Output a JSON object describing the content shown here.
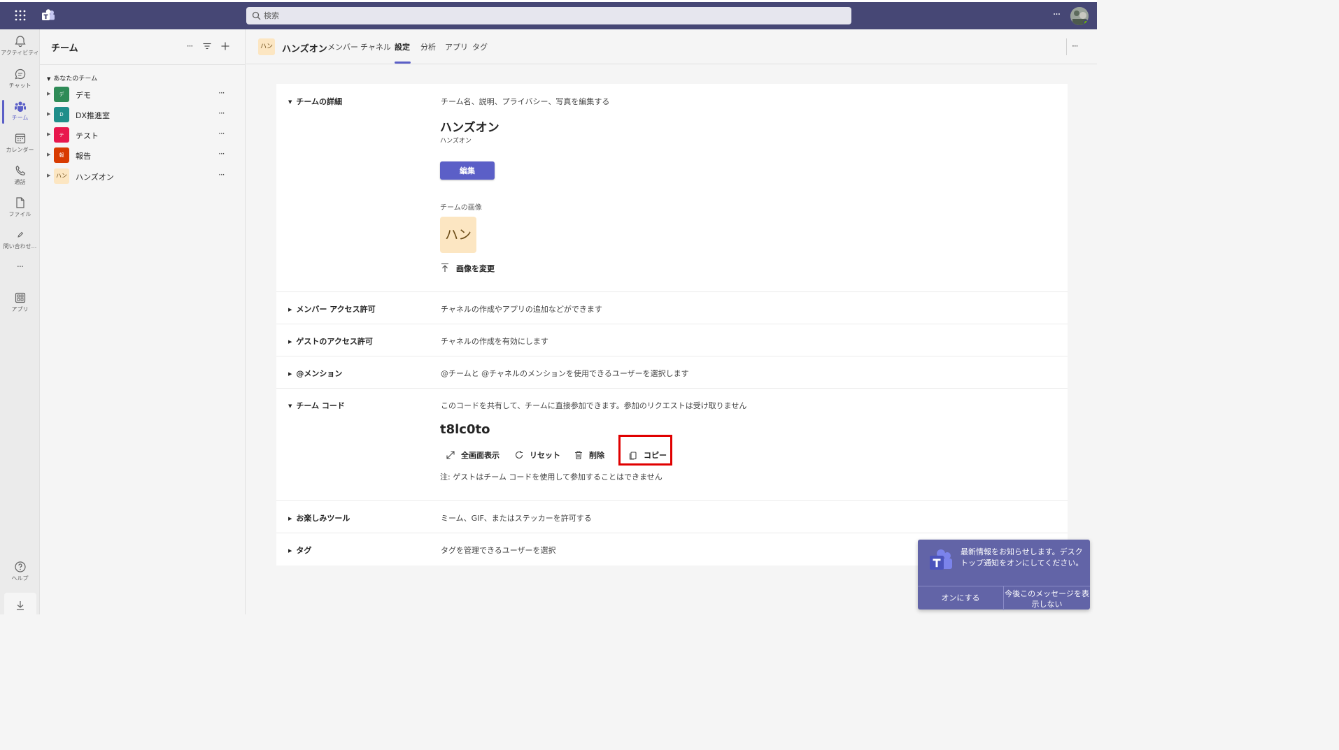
{
  "app": {
    "search_placeholder": "検索",
    "more": "···",
    "colors": {
      "header": "#464775",
      "accent": "#5b5fc7",
      "highlight": "#e00000"
    }
  },
  "rail": {
    "items": [
      {
        "label": "アクティビティ",
        "icon": "bell-icon"
      },
      {
        "label": "チャット",
        "icon": "chat-icon"
      },
      {
        "label": "チーム",
        "icon": "teams-icon"
      },
      {
        "label": "カレンダー",
        "icon": "calendar-icon"
      },
      {
        "label": "通話",
        "icon": "phone-icon"
      },
      {
        "label": "ファイル",
        "icon": "file-icon"
      },
      {
        "label": "問い合わせ...",
        "icon": "pen-icon"
      },
      {
        "label": "···",
        "icon": "more-icon"
      },
      {
        "label": "アプリ",
        "icon": "apps-icon"
      },
      {
        "label": "ヘルプ",
        "icon": "help-icon"
      }
    ]
  },
  "teams_panel": {
    "title": "チーム",
    "more": "···",
    "section_label": "あなたのチーム",
    "teams": [
      {
        "tile": "デ",
        "name": "デモ",
        "color": "#2e8b57",
        "more": "···"
      },
      {
        "tile": "D",
        "name": "DX推進室",
        "color": "#1f8e8a",
        "more": "···"
      },
      {
        "tile": "テ",
        "name": "テスト",
        "color": "#e8174d",
        "more": "···"
      },
      {
        "tile": "報",
        "name": "報告",
        "color": "#d83b01",
        "more": "···"
      },
      {
        "tile": "ハン",
        "name": "ハンズオン",
        "color": "#fce6c2",
        "more": "···"
      }
    ]
  },
  "header": {
    "tile": "ハン",
    "team_name": "ハンズオン",
    "tabs": [
      "メンバー",
      "チャネル",
      "設定",
      "分析",
      "アプリ",
      "タグ"
    ],
    "active_tab": "設定",
    "more": "···"
  },
  "settings": {
    "details": {
      "title": "チームの詳細",
      "desc": "チーム名、説明、プライバシー、写真を編集する",
      "team_name": "ハンズオン",
      "team_desc": "ハンズオン",
      "edit_label": "編集",
      "image_label": "チームの画像",
      "image_tile": "ハン",
      "change_image_label": "画像を変更"
    },
    "member_access": {
      "title": "メンバー アクセス許可",
      "desc": "チャネルの作成やアプリの追加などができます"
    },
    "guest_access": {
      "title": "ゲストのアクセス許可",
      "desc": "チャネルの作成を有効にします"
    },
    "mentions": {
      "title": "@メンション",
      "desc": "@チームと @チャネルのメンションを使用できるユーザーを選択します"
    },
    "team_code": {
      "title": "チーム コード",
      "desc": "このコードを共有して、チームに直接参加できます。参加のリクエストは受け取りません",
      "code": "t8lc0to",
      "fullscreen_label": "全画面表示",
      "reset_label": "リセット",
      "delete_label": "削除",
      "copy_label": "コピー",
      "note": "注: ゲストはチーム コードを使用して参加することはできません"
    },
    "fun": {
      "title": "お楽しみツール",
      "desc": "ミーム、GIF、またはステッカーを許可する"
    },
    "tags": {
      "title": "タグ",
      "desc": "タグを管理できるユーザーを選択"
    }
  },
  "toast": {
    "message": "最新情報をお知らせします。デスクトップ通知をオンにしてください。",
    "enable_label": "オンにする",
    "dismiss_label": "今後このメッセージを表示しない"
  }
}
